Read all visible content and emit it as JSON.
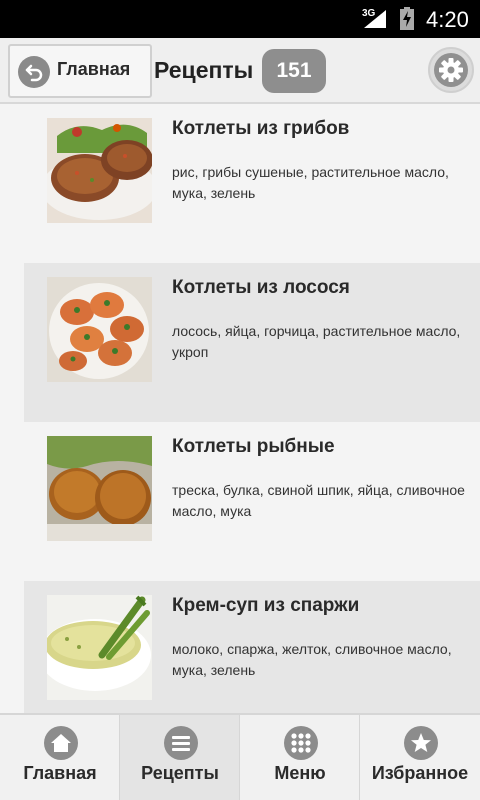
{
  "status_bar": {
    "network": "3G",
    "time": "4:20",
    "icons": [
      "signal-icon",
      "battery-charging-icon"
    ]
  },
  "header": {
    "home_button_label": "Главная",
    "title": "Рецепты",
    "count": "151",
    "icons": [
      "back-arrow-icon",
      "gear-icon"
    ]
  },
  "recipes": [
    {
      "title": "Котлеты из грибов",
      "ingredients": "рис, грибы сушеные, растительное масло, мука, зелень"
    },
    {
      "title": "Котлеты из лосося",
      "ingredients": "лосось, яйца, горчица, растительное масло, укроп"
    },
    {
      "title": "Котлеты рыбные",
      "ingredients": "треска, булка, свиной шпик, яйца, сливочное масло, мука"
    },
    {
      "title": "Крем-суп из спаржи",
      "ingredients": "молоко, спаржа, желток, сливочное масло, мука, зелень"
    }
  ],
  "bottom_nav": {
    "items": [
      {
        "label": "Главная",
        "icon": "home-icon"
      },
      {
        "label": "Рецепты",
        "icon": "list-icon",
        "active": true
      },
      {
        "label": "Меню",
        "icon": "grid-icon"
      },
      {
        "label": "Избранное",
        "icon": "star-icon"
      }
    ]
  },
  "colors": {
    "background": "#f4f4f4",
    "alt_row": "#e6e6e6",
    "badge": "#8e8e8e",
    "icon_gray": "#8c8c8c",
    "text": "#2a2a2a"
  }
}
